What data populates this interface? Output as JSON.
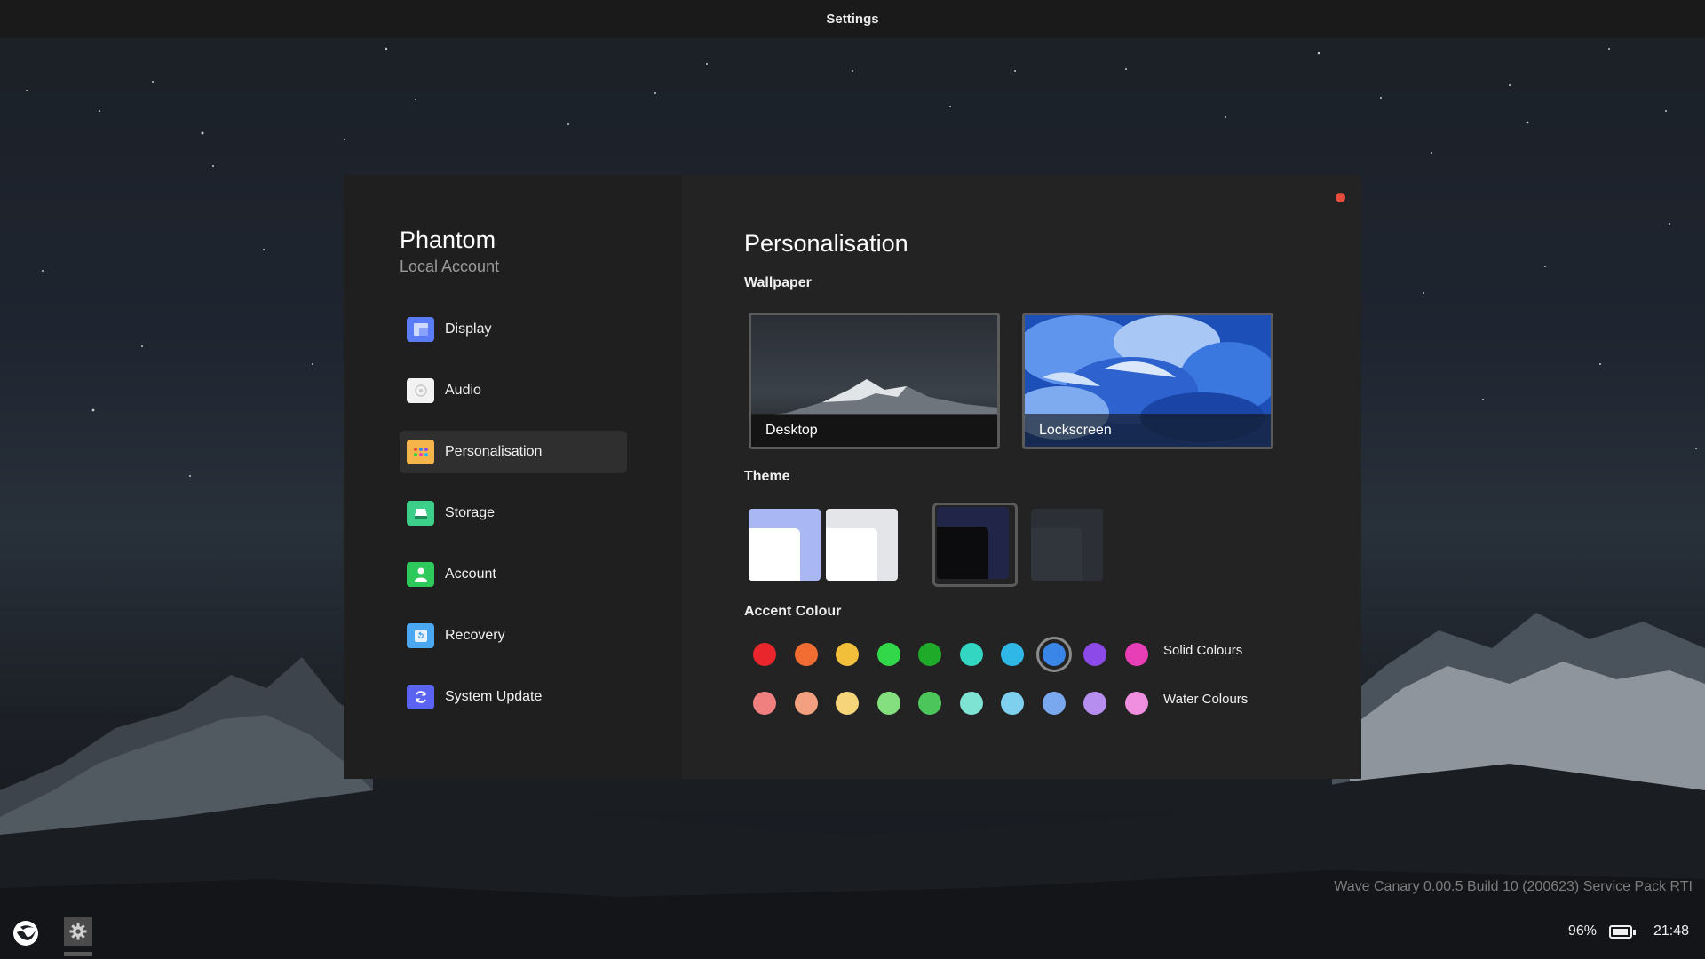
{
  "window_title": "Settings",
  "user": {
    "name": "Phantom",
    "type": "Local Account"
  },
  "nav": [
    {
      "label": "Display",
      "icon": "display-icon",
      "color": "#5b7cf7"
    },
    {
      "label": "Audio",
      "icon": "audio-icon",
      "color": "#f2f2f2"
    },
    {
      "label": "Personalisation",
      "icon": "palette-icon",
      "color": "#f5b54a",
      "active": true
    },
    {
      "label": "Storage",
      "icon": "storage-icon",
      "color": "#3ccf8a"
    },
    {
      "label": "Account",
      "icon": "user-icon",
      "color": "#2ec95b"
    },
    {
      "label": "Recovery",
      "icon": "recovery-icon",
      "color": "#4aa7f2"
    },
    {
      "label": "System Update",
      "icon": "update-icon",
      "color": "#5a63f2"
    }
  ],
  "content": {
    "title": "Personalisation",
    "wallpaper_label": "Wallpaper",
    "wallpapers": [
      "Desktop",
      "Lockscreen"
    ],
    "theme_label": "Theme",
    "accent_label": "Accent Colour",
    "solid_label": "Solid Colours",
    "water_label": "Water Colours",
    "solid_colours": [
      "#e8262b",
      "#f26d31",
      "#f2bf3a",
      "#33d84a",
      "#1faa2a",
      "#33d6c0",
      "#2fb7e8",
      "#3a86e8",
      "#8c4ae8",
      "#e83fb7"
    ],
    "water_colours": [
      "#f07f7f",
      "#f2a07f",
      "#f5d47a",
      "#84e07e",
      "#4cc65a",
      "#7fe3d3",
      "#7fd0ef",
      "#7aa8ef",
      "#b58ef0",
      "#f08fe0"
    ],
    "selected_solid_index": 7
  },
  "version": "Wave Canary 0.00.5 Build 10 (200623) Service Pack RTI",
  "tray": {
    "battery": "96%",
    "battery_level": 0.96,
    "time": "21:48"
  }
}
